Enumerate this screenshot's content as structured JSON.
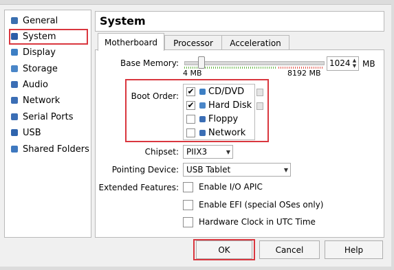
{
  "sidebar": {
    "items": [
      {
        "label": "General",
        "icon": "general-icon",
        "color": "#3a6fb0"
      },
      {
        "label": "System",
        "icon": "system-icon",
        "color": "#2c5ea8"
      },
      {
        "label": "Display",
        "icon": "display-icon",
        "color": "#3d7fc4"
      },
      {
        "label": "Storage",
        "icon": "storage-icon",
        "color": "#4a86c8"
      },
      {
        "label": "Audio",
        "icon": "audio-icon",
        "color": "#3b6eb5"
      },
      {
        "label": "Network",
        "icon": "network-icon",
        "color": "#3b6eb5"
      },
      {
        "label": "Serial Ports",
        "icon": "serial-ports-icon",
        "color": "#3b6eb5"
      },
      {
        "label": "USB",
        "icon": "usb-icon",
        "color": "#2f64ad"
      },
      {
        "label": "Shared Folders",
        "icon": "shared-folders-icon",
        "color": "#3e78bf"
      }
    ],
    "selected": "System"
  },
  "header": {
    "title": "System"
  },
  "tabs": [
    {
      "label": "Motherboard",
      "active": true
    },
    {
      "label": "Processor",
      "active": false
    },
    {
      "label": "Acceleration",
      "active": false
    }
  ],
  "motherboard": {
    "base_memory": {
      "label": "Base Memory:",
      "value": "1024",
      "unit": "MB",
      "min_label": "4 MB",
      "max_label": "8192 MB",
      "slider_fraction": 0.125
    },
    "boot_order": {
      "label": "Boot Order:",
      "items": [
        {
          "label": "CD/DVD",
          "checked": true,
          "check": "✔",
          "icon": "cd-dvd-icon",
          "color": "#3d7fc4"
        },
        {
          "label": "Hard Disk",
          "checked": true,
          "check": "✔",
          "icon": "hard-disk-icon",
          "color": "#4a86c8"
        },
        {
          "label": "Floppy",
          "checked": false,
          "check": "",
          "icon": "floppy-icon",
          "color": "#3b6eb5"
        },
        {
          "label": "Network",
          "checked": false,
          "check": "",
          "icon": "network-icon",
          "color": "#3b6eb5"
        }
      ]
    },
    "chipset": {
      "label": "Chipset:",
      "value": "PIIX3"
    },
    "pointing_device": {
      "label": "Pointing Device:",
      "value": "USB Tablet"
    },
    "extended_features": {
      "label": "Extended Features:",
      "options": [
        {
          "label": "Enable I/O APIC",
          "checked": false
        },
        {
          "label": "Enable EFI (special OSes only)",
          "checked": false
        },
        {
          "label": "Hardware Clock in UTC Time",
          "checked": false
        }
      ]
    }
  },
  "buttons": {
    "ok": "OK",
    "cancel": "Cancel",
    "help": "Help"
  },
  "colors": {
    "highlight": "#d9363e",
    "slider_green": "#69b74a",
    "slider_red": "#e2574c"
  }
}
